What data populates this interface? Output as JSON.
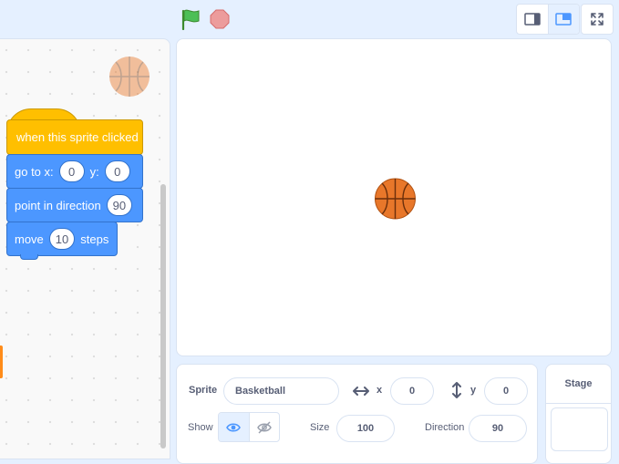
{
  "code": {
    "hat_block": "when this sprite clicked",
    "goto": {
      "label": "go to x:",
      "x": "0",
      "y_label": "y:",
      "y": "0"
    },
    "point": {
      "label": "point in direction",
      "value": "90"
    },
    "move": {
      "label": "move",
      "value": "10",
      "suffix": "steps"
    }
  },
  "sprite_info": {
    "sprite_label": "Sprite",
    "sprite_name": "Basketball",
    "x_label": "x",
    "x_value": "0",
    "y_label": "y",
    "y_value": "0",
    "show_label": "Show",
    "size_label": "Size",
    "size_value": "100",
    "direction_label": "Direction",
    "direction_value": "90"
  },
  "stage_selector": {
    "title": "Stage"
  },
  "icons": {
    "green_flag": "green-flag-icon",
    "stop": "stop-icon",
    "small_stage": "small-stage-layout-icon",
    "normal_stage": "normal-stage-layout-icon",
    "fullscreen": "fullscreen-icon",
    "show": "eye-icon",
    "hide": "eye-slash-icon"
  },
  "colors": {
    "event_block": "#ffbf00",
    "motion_block": "#4c97ff",
    "accent": "#4c97ff",
    "basketball": "#e8772a"
  }
}
